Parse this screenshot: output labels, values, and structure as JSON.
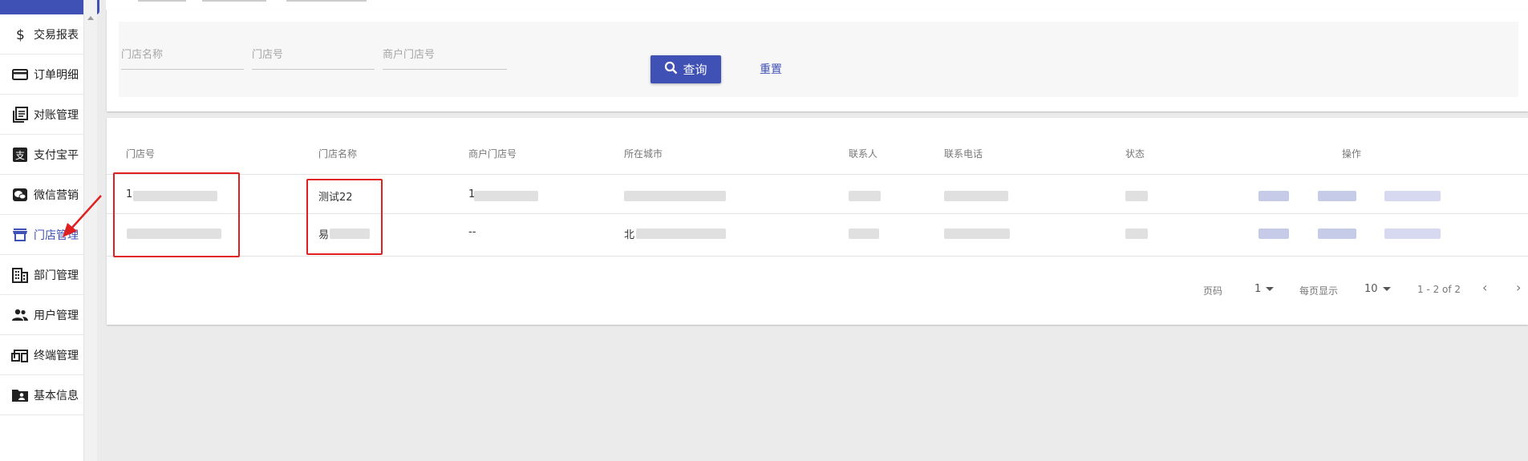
{
  "sidebar": {
    "items": [
      {
        "label": "交易报表",
        "icon": "dollar-icon",
        "active": false
      },
      {
        "label": "订单明细",
        "icon": "credit-card-icon",
        "active": false
      },
      {
        "label": "对账管理",
        "icon": "ledger-icon",
        "active": false
      },
      {
        "label": "支付宝平台",
        "icon": "alipay-icon",
        "active": false
      },
      {
        "label": "微信营销",
        "icon": "wechat-icon",
        "active": false
      },
      {
        "label": "门店管理",
        "icon": "store-icon",
        "active": true
      },
      {
        "label": "部门管理",
        "icon": "building-icon",
        "active": false
      },
      {
        "label": "用户管理",
        "icon": "users-icon",
        "active": false
      },
      {
        "label": "终端管理",
        "icon": "devices-icon",
        "active": false
      },
      {
        "label": "基本信息",
        "icon": "folder-user-icon",
        "active": false
      }
    ]
  },
  "search": {
    "store_name_placeholder": "门店名称",
    "store_no_placeholder": "门店号",
    "merchant_store_no_placeholder": "商户门店号",
    "search_label": "查询",
    "reset_label": "重置"
  },
  "table": {
    "headers": [
      "门店号",
      "门店名称",
      "商户门店号",
      "所在城市",
      "联系人",
      "联系电话",
      "状态",
      "操作"
    ],
    "rows": [
      {
        "store_no": "1",
        "store_name": "测试22",
        "merchant_store_no": "1",
        "city": "",
        "contact": "",
        "phone": "",
        "status": "",
        "actions": ""
      },
      {
        "store_no": "",
        "store_name": "易",
        "merchant_store_no": "--",
        "city": "北",
        "contact": "",
        "phone": "",
        "status": "",
        "actions": ""
      }
    ]
  },
  "pagination": {
    "page_label": "页码",
    "page_value": "1",
    "per_page_label": "每页显示",
    "per_page_value": "10",
    "range_text": "1 - 2 of 2"
  },
  "colors": {
    "primary": "#3f51b5",
    "annotation": "#e02020"
  }
}
